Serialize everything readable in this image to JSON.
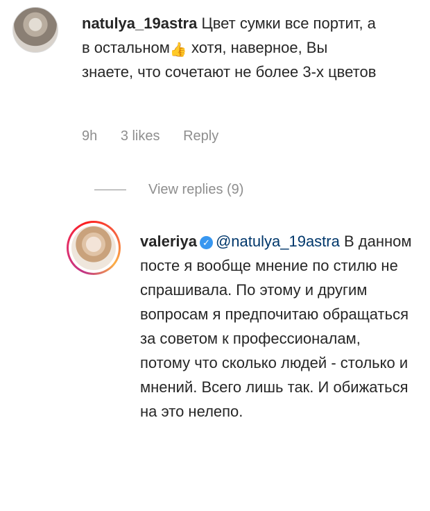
{
  "comment1": {
    "username": "natulya_19astra",
    "text_part1": " Цвет сумки все портит, а в остальном",
    "emoji": "👍",
    "text_part2": " хотя, наверное, Вы знаете, что сочетают не более 3-х цветов",
    "time": "9h",
    "likes": "3 likes",
    "reply_label": "Reply",
    "view_replies": "View replies (9)"
  },
  "comment2": {
    "username": "valeriya",
    "verified_icon": "verified-badge-icon",
    "mention": "@natulya_19astra",
    "text": " В данном посте я вообще мнение по стилю не спрашивала. По этому и другим вопросам я предпочитаю обращаться за советом к профессионалам, потому что сколько людей - столько и мнений. Всего лишь так. И обижаться на это нелепо."
  },
  "colors": {
    "text": "#262626",
    "secondary": "#8e8e8e",
    "mention": "#00376b",
    "verified": "#3897f0"
  }
}
